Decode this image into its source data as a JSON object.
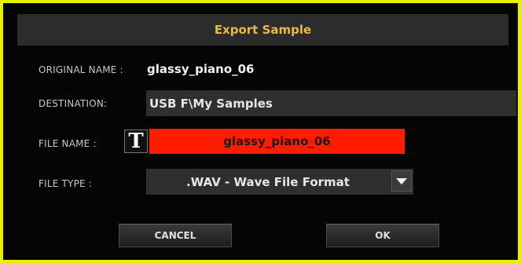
{
  "dialog": {
    "title": "Export Sample",
    "original_name_label": "ORIGINAL NAME :",
    "original_name_value": "glassy_piano_06",
    "destination_label": "DESTINATION:",
    "destination_value": "USB F\\My Samples",
    "file_name_label": "FILE NAME :",
    "text_edit_icon": "T",
    "file_name_value": "glassy_piano_06",
    "file_type_label": "FILE TYPE :",
    "file_type_value": ".WAV - Wave File Format",
    "cancel_label": "CANCEL",
    "ok_label": "OK"
  },
  "colors": {
    "background_frame": "#e8f000",
    "title": "#e8b84a",
    "file_name_field": "#ff1c00"
  },
  "icons": {
    "text_edit": "text-edit-icon",
    "dropdown": "triangle-down-icon"
  }
}
